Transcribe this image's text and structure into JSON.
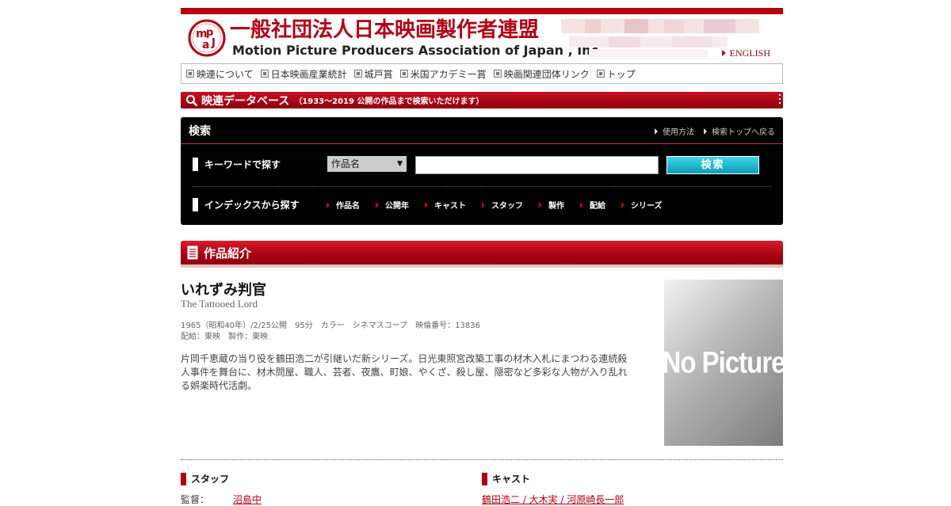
{
  "header": {
    "org_name_jp": "一般社団法人日本映画製作者連盟",
    "org_name_en": "Motion Picture Producers Association of Japan , Inc.",
    "english_link": "ENGLISH",
    "brand_color": "#b3000c"
  },
  "nav": {
    "items": [
      {
        "label": "映連について"
      },
      {
        "label": "日本映画産業統計"
      },
      {
        "label": "城戸賞"
      },
      {
        "label": "米国アカデミー賞"
      },
      {
        "label": "映画関連団体リンク"
      },
      {
        "label": "トップ"
      }
    ]
  },
  "db_banner": {
    "title": "映連データベース",
    "subtitle": "（1933～2019 公開の作品まで検索いただけます）"
  },
  "search": {
    "title": "検索",
    "links": [
      {
        "label": "使用方法"
      },
      {
        "label": "検索トップへ戻る"
      }
    ],
    "keyword_label": "キーワードで探す",
    "select_value": "作品名",
    "keyword_value": "",
    "button_label": "検索",
    "button_color": "#19b3c8",
    "index_label": "インデックスから探す",
    "index_links": [
      {
        "label": "作品名"
      },
      {
        "label": "公開年"
      },
      {
        "label": "キャスト"
      },
      {
        "label": "スタッフ"
      },
      {
        "label": "製作"
      },
      {
        "label": "配給"
      },
      {
        "label": "シリーズ"
      }
    ]
  },
  "intro": {
    "title": "作品紹介"
  },
  "film": {
    "title": "いれずみ判官",
    "title_en": "The Tattooed Lord",
    "meta": "1965（昭和40年）/2/25公開　95分　カラー　シネマスコープ　映倫番号：13836",
    "meta2": "配給：東映　製作：東映",
    "description": "片岡千恵蔵の当り役を鶴田浩二が引継いだ新シリーズ。日光東照宮改築工事の材木入札にまつわる連続殺人事件を舞台に、材木問屋、職人、芸者、夜鷹、町娘、やくざ、殺し屋、隠密など多彩な人物が入り乱れる娯楽時代活劇。",
    "no_picture": "No Picture"
  },
  "staff": {
    "heading": "スタッフ",
    "first_role": "監督：",
    "first_name": "沼島中"
  },
  "cast": {
    "heading": "キャスト",
    "first_line": "鶴田浩二 / 大木実 / 河原崎長一郎"
  }
}
